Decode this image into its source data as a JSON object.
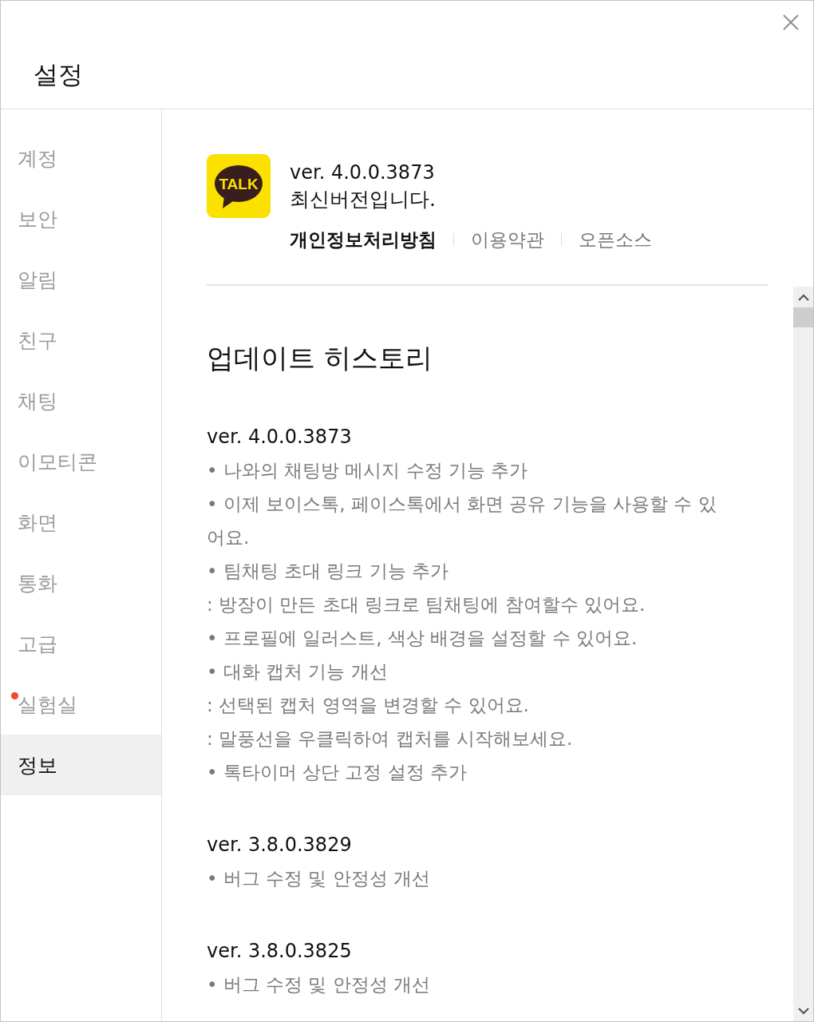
{
  "window": {
    "title": "설정"
  },
  "sidebar": {
    "items": [
      {
        "label": "계정",
        "selected": false,
        "new": false
      },
      {
        "label": "보안",
        "selected": false,
        "new": false
      },
      {
        "label": "알림",
        "selected": false,
        "new": false
      },
      {
        "label": "친구",
        "selected": false,
        "new": false
      },
      {
        "label": "채팅",
        "selected": false,
        "new": false
      },
      {
        "label": "이모티콘",
        "selected": false,
        "new": false
      },
      {
        "label": "화면",
        "selected": false,
        "new": false
      },
      {
        "label": "통화",
        "selected": false,
        "new": false
      },
      {
        "label": "고급",
        "selected": false,
        "new": false
      },
      {
        "label": "실험실",
        "selected": false,
        "new": true
      },
      {
        "label": "정보",
        "selected": true,
        "new": false
      }
    ]
  },
  "about": {
    "logo_text": "TALK",
    "version": "ver. 4.0.0.3873",
    "status": "최신버전입니다.",
    "links": [
      {
        "label": "개인정보처리방침",
        "emphasized": true
      },
      {
        "label": "이용약관",
        "emphasized": false
      },
      {
        "label": "오픈소스",
        "emphasized": false
      }
    ]
  },
  "history": {
    "title": "업데이트 히스토리",
    "releases": [
      {
        "version": "ver. 4.0.0.3873",
        "notes": [
          "• 나와의 채팅방 메시지 수정 기능 추가",
          "• 이제 보이스톡, 페이스톡에서 화면 공유 기능을 사용할 수 있어요.",
          "• 팀채팅 초대 링크 기능 추가",
          ": 방장이 만든 초대 링크로 팀채팅에 참여할수 있어요.",
          "• 프로필에 일러스트, 색상 배경을 설정할 수 있어요.",
          "• 대화 캡처 기능 개선",
          ": 선택된 캡처 영역을 변경할 수 있어요.",
          ": 말풍선을 우클릭하여 캡처를 시작해보세요.",
          "• 톡타이머 상단 고정 설정 추가"
        ]
      },
      {
        "version": "ver. 3.8.0.3829",
        "notes": [
          "• 버그 수정 및 안정성 개선"
        ]
      },
      {
        "version": "ver. 3.8.0.3825",
        "notes": [
          "• 버그 수정 및 안정성 개선"
        ]
      }
    ]
  }
}
